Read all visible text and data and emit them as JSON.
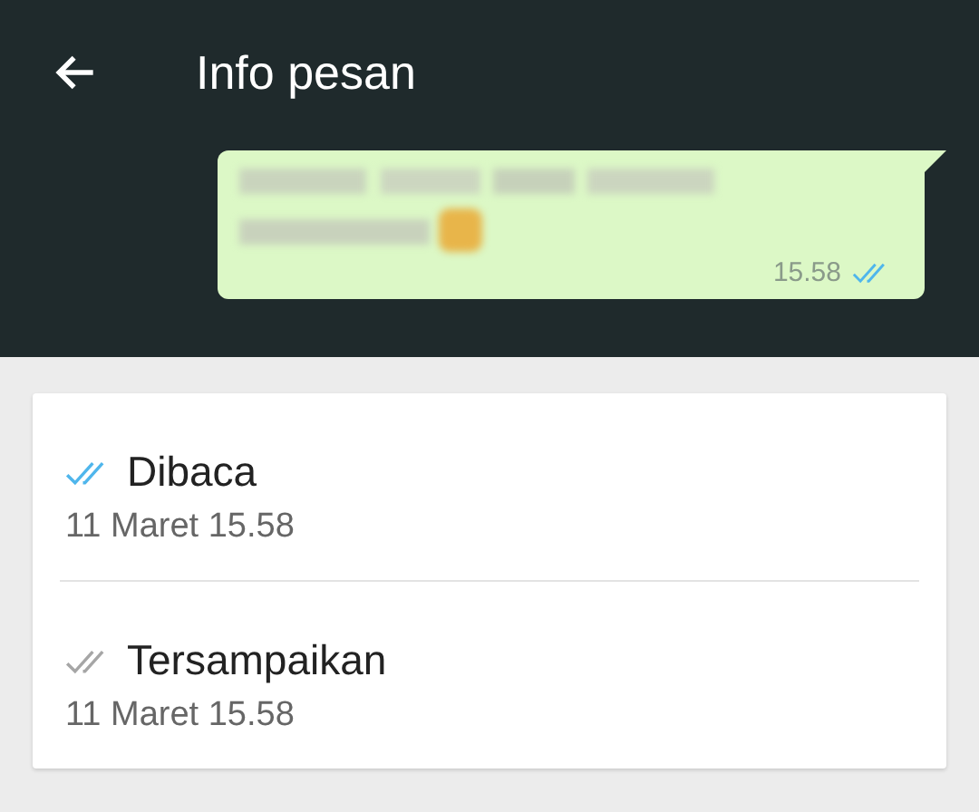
{
  "app_bar": {
    "title": "Info pesan"
  },
  "message": {
    "time": "15.58",
    "read": true
  },
  "receipts": [
    {
      "label": "Dibaca",
      "time": "11 Maret 15.58",
      "color": "#4fb6ec"
    },
    {
      "label": "Tersampaikan",
      "time": "11 Maret 15.58",
      "color": "#a6a6a6"
    }
  ]
}
